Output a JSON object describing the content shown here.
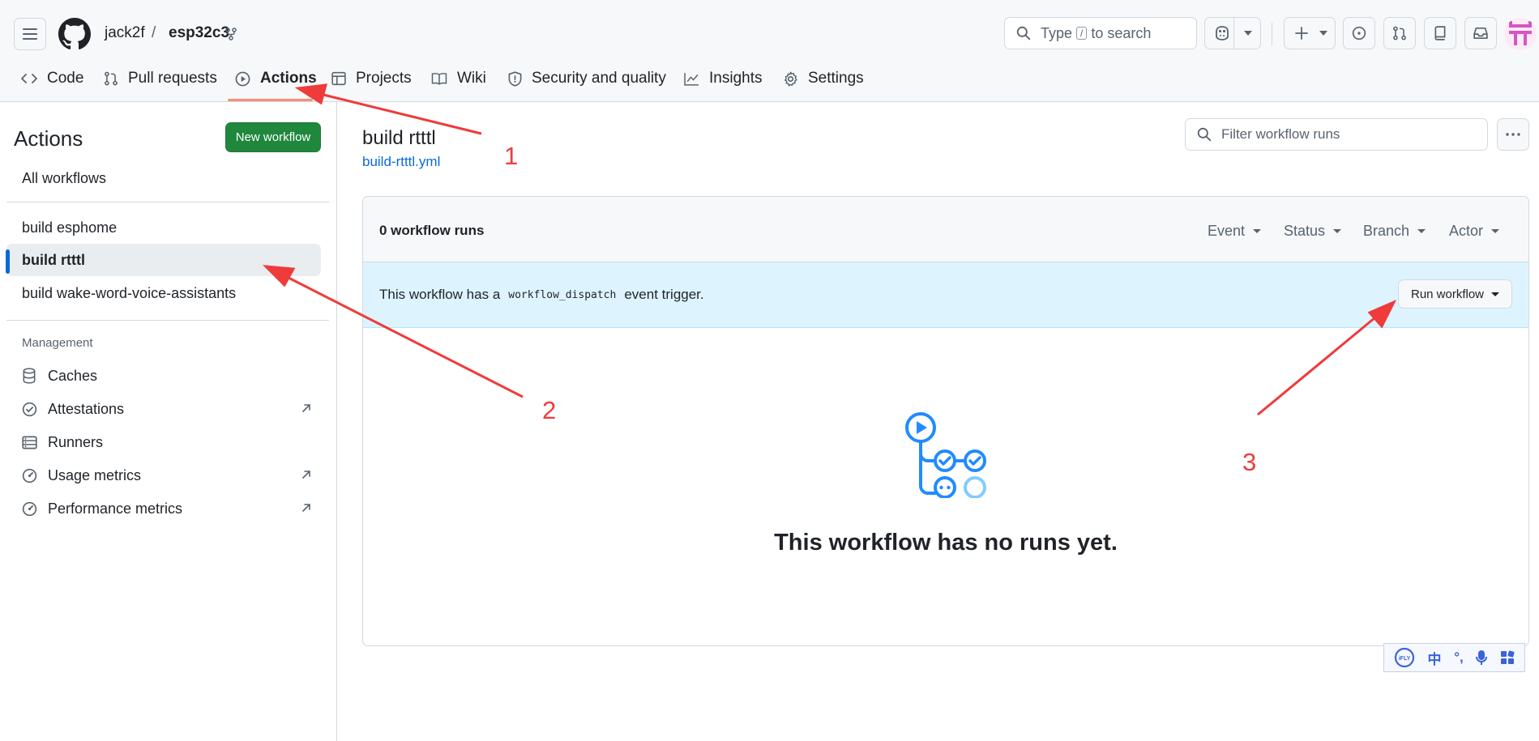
{
  "header": {
    "owner": "jack2f",
    "separator": "/",
    "repo": "esp32c3",
    "search": {
      "prefix": "Type",
      "key": "/",
      "suffix": "to search"
    }
  },
  "tabs": [
    {
      "label": "Code",
      "icon": "code-icon"
    },
    {
      "label": "Pull requests",
      "icon": "git-pull-request-icon"
    },
    {
      "label": "Actions",
      "icon": "play-icon",
      "active": true
    },
    {
      "label": "Projects",
      "icon": "table-icon"
    },
    {
      "label": "Wiki",
      "icon": "book-icon"
    },
    {
      "label": "Security and quality",
      "icon": "shield-icon"
    },
    {
      "label": "Insights",
      "icon": "graph-icon"
    },
    {
      "label": "Settings",
      "icon": "gear-icon"
    }
  ],
  "sidebar": {
    "title": "Actions",
    "new_workflow": "New workflow",
    "all_workflows": "All workflows",
    "workflows": [
      {
        "label": "build esphome"
      },
      {
        "label": "build rtttl",
        "selected": true
      },
      {
        "label": "build wake-word-voice-assistants"
      }
    ],
    "management_heading": "Management",
    "management": [
      {
        "label": "Caches",
        "icon": "database-icon",
        "external": false
      },
      {
        "label": "Attestations",
        "icon": "verified-icon",
        "external": true
      },
      {
        "label": "Runners",
        "icon": "server-icon",
        "external": false
      },
      {
        "label": "Usage metrics",
        "icon": "meter-icon",
        "external": true
      },
      {
        "label": "Performance metrics",
        "icon": "meter-icon",
        "external": true
      }
    ]
  },
  "main": {
    "title": "build rtttl",
    "file": "build-rtttl.yml",
    "filter_placeholder": "Filter workflow runs",
    "runs_count": "0 workflow runs",
    "filters": [
      "Event",
      "Status",
      "Branch",
      "Actor"
    ],
    "dispatch": {
      "before": "This workflow has a",
      "code": "workflow_dispatch",
      "after": "event trigger."
    },
    "run_workflow": "Run workflow",
    "empty": "This workflow has no runs yet."
  },
  "ime": {
    "brand": "iFLY",
    "lang": "中",
    "punct": "°,"
  },
  "annotations": [
    "1",
    "2",
    "3"
  ],
  "colors": {
    "accent": "#0969da",
    "primary_button": "#1f883d",
    "tab_underline": "#fd8c73",
    "annotation": "#ef3b3b",
    "dispatch_bg": "#ddf4ff"
  }
}
